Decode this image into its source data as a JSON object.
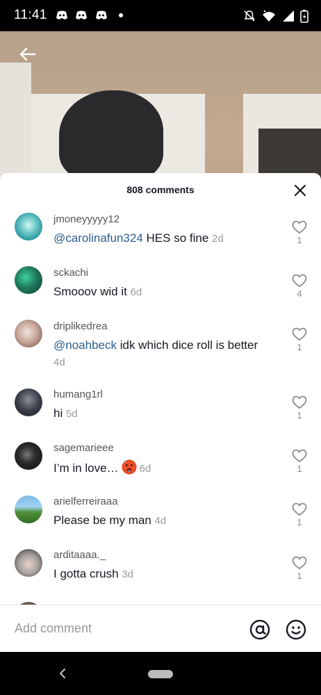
{
  "status": {
    "time": "11:41"
  },
  "sheet": {
    "title": "808 comments"
  },
  "comments": [
    {
      "username": "jmoneyyyyy12",
      "mention": "@carolinafun324",
      "text": " HES so fine ",
      "age": "2d",
      "likes": "1",
      "avatar_color": "#3fb3b8"
    },
    {
      "username": "sckachi",
      "mention": "",
      "text": "Smooov wid it ",
      "age": "6d",
      "likes": "4",
      "avatar_color": "#1f5a4a"
    },
    {
      "username": "driplikedrea",
      "mention": "@noahbeck",
      "text": " idk which dice roll is better ",
      "age": "4d",
      "likes": "1",
      "avatar_color": "#c9a89a"
    },
    {
      "username": "humang1rl",
      "mention": "",
      "text": "hi ",
      "age": "5d",
      "likes": "1",
      "avatar_color": "#3b3f4a"
    },
    {
      "username": "sagemarieee",
      "mention": "",
      "text": "I’m in love…",
      "age": "6d",
      "likes": "1",
      "avatar_color": "#1b1b1b",
      "emoji": "hot-face"
    },
    {
      "username": "arielferreiraaa",
      "mention": "",
      "text": "Please be my man ",
      "age": "4d",
      "likes": "1",
      "avatar_color": "#6aa84f"
    },
    {
      "username": "arditaaaa._",
      "mention": "",
      "text": "I gotta crush ",
      "age": "3d",
      "likes": "1",
      "avatar_color": "#a9a3a0"
    }
  ],
  "input": {
    "placeholder": "Add comment"
  },
  "icons": {
    "back": "arrow-left-icon",
    "close": "close-icon",
    "like": "heart-outline-icon",
    "mention": "at-icon",
    "emoji": "smiley-icon"
  }
}
